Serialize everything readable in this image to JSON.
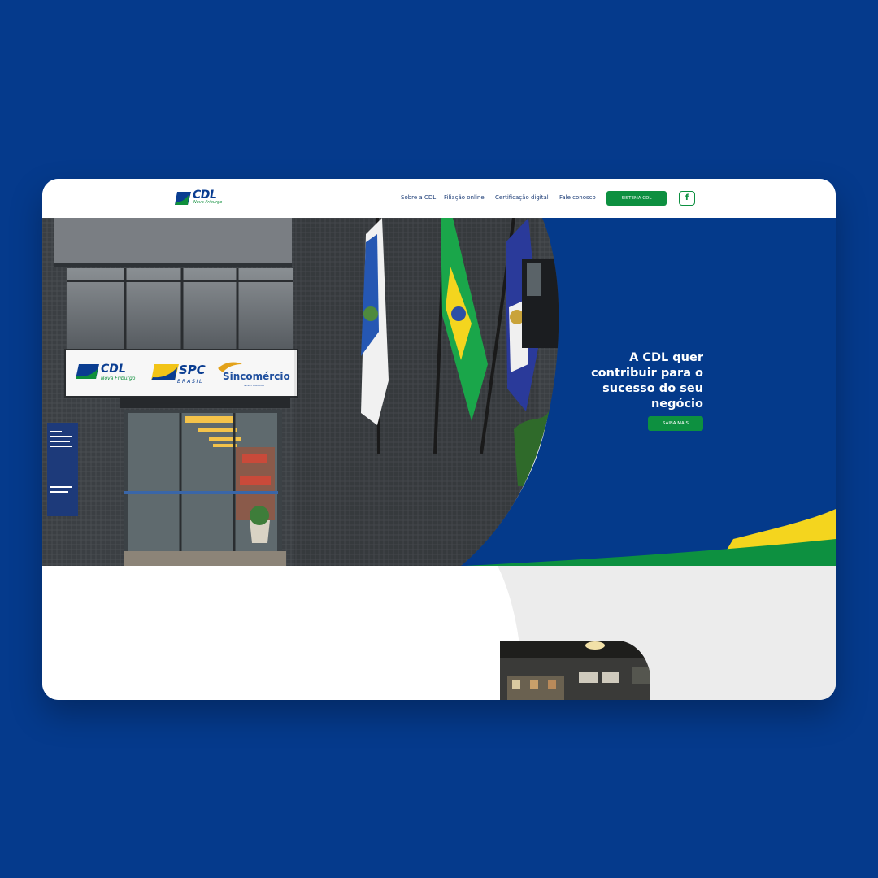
{
  "logo": {
    "name": "CDL",
    "subtitle": "Nova Friburgo"
  },
  "nav": {
    "items": [
      {
        "label": "Sobre a CDL"
      },
      {
        "label": "Filiação online"
      },
      {
        "label": "Certificação digital"
      },
      {
        "label": "Fale conosco"
      }
    ],
    "cta_label": "SISTEMA CDL",
    "facebook_icon": "f"
  },
  "hero": {
    "heading": "A CDL quer contribuir para o sucesso do seu negócio",
    "button_label": "SAIBA MAIS",
    "signage": {
      "cdl": "CDL",
      "cdl_sub": "Nova Friburgo",
      "spc": "SPC",
      "spc_sub": "BRASIL",
      "sincomercio": "Sincomércio",
      "sincomercio_sub": "NOVA FRIBURGO"
    }
  },
  "colors": {
    "page_background": "#053a8c",
    "brand_blue": "#0a3d91",
    "brand_green": "#0d9040",
    "brand_yellow": "#f4d51e"
  }
}
